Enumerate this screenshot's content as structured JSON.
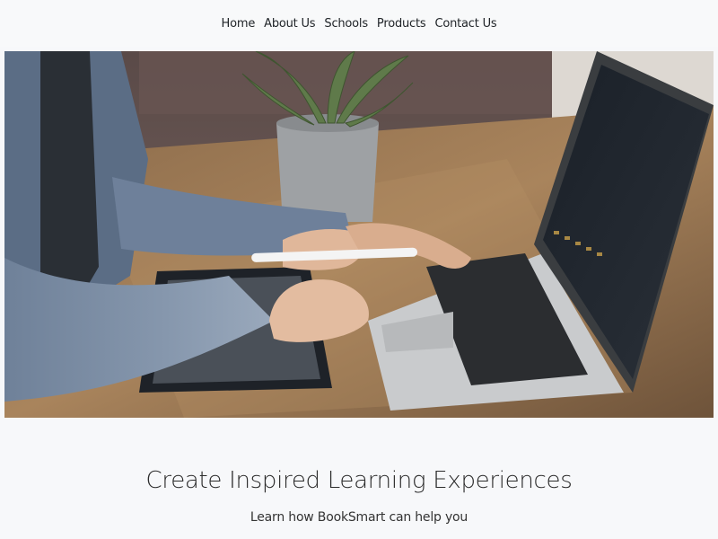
{
  "nav": {
    "items": [
      {
        "label": "Home"
      },
      {
        "label": "About Us"
      },
      {
        "label": "Schools"
      },
      {
        "label": "Products"
      },
      {
        "label": "Contact Us"
      }
    ]
  },
  "hero": {
    "image_alt": "person-using-laptop-and-tablet-photo"
  },
  "intro": {
    "headline": "Create Inspired Learning Experiences",
    "subline": "Learn how BookSmart can help you"
  },
  "colors": {
    "page_background": "#f7f8fa",
    "nav_text": "#212529",
    "headline_text": "#2b2b2b"
  }
}
